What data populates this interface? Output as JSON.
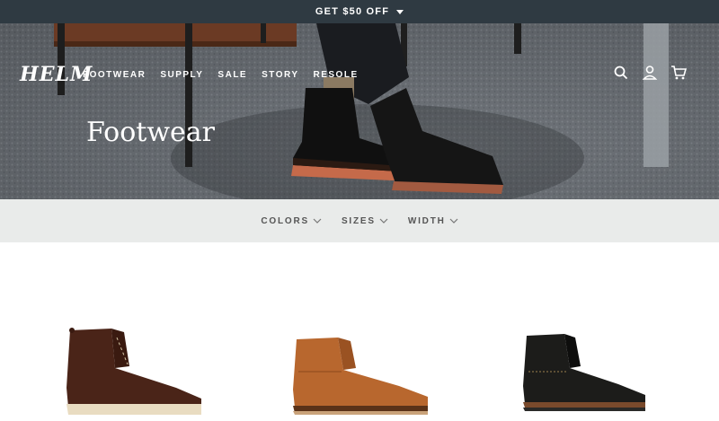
{
  "promo": {
    "text": "GET $50 OFF"
  },
  "header": {
    "logo": "HELM",
    "nav": [
      "FOOTWEAR",
      "SUPPLY",
      "SALE",
      "STORY",
      "RESOLE"
    ]
  },
  "hero": {
    "title": "Footwear"
  },
  "filters": [
    {
      "label": "COLORS"
    },
    {
      "label": "SIZES"
    },
    {
      "label": "WIDTH"
    }
  ],
  "products": [
    {
      "icon": "brown-boot-image",
      "color": "#4a2418"
    },
    {
      "icon": "tan-boot-image",
      "color": "#b8672e"
    },
    {
      "icon": "black-boot-image",
      "color": "#1c1c1a"
    }
  ],
  "colors": {
    "promo_bg": "#2f3a42",
    "filter_bg": "#e9ebea"
  }
}
